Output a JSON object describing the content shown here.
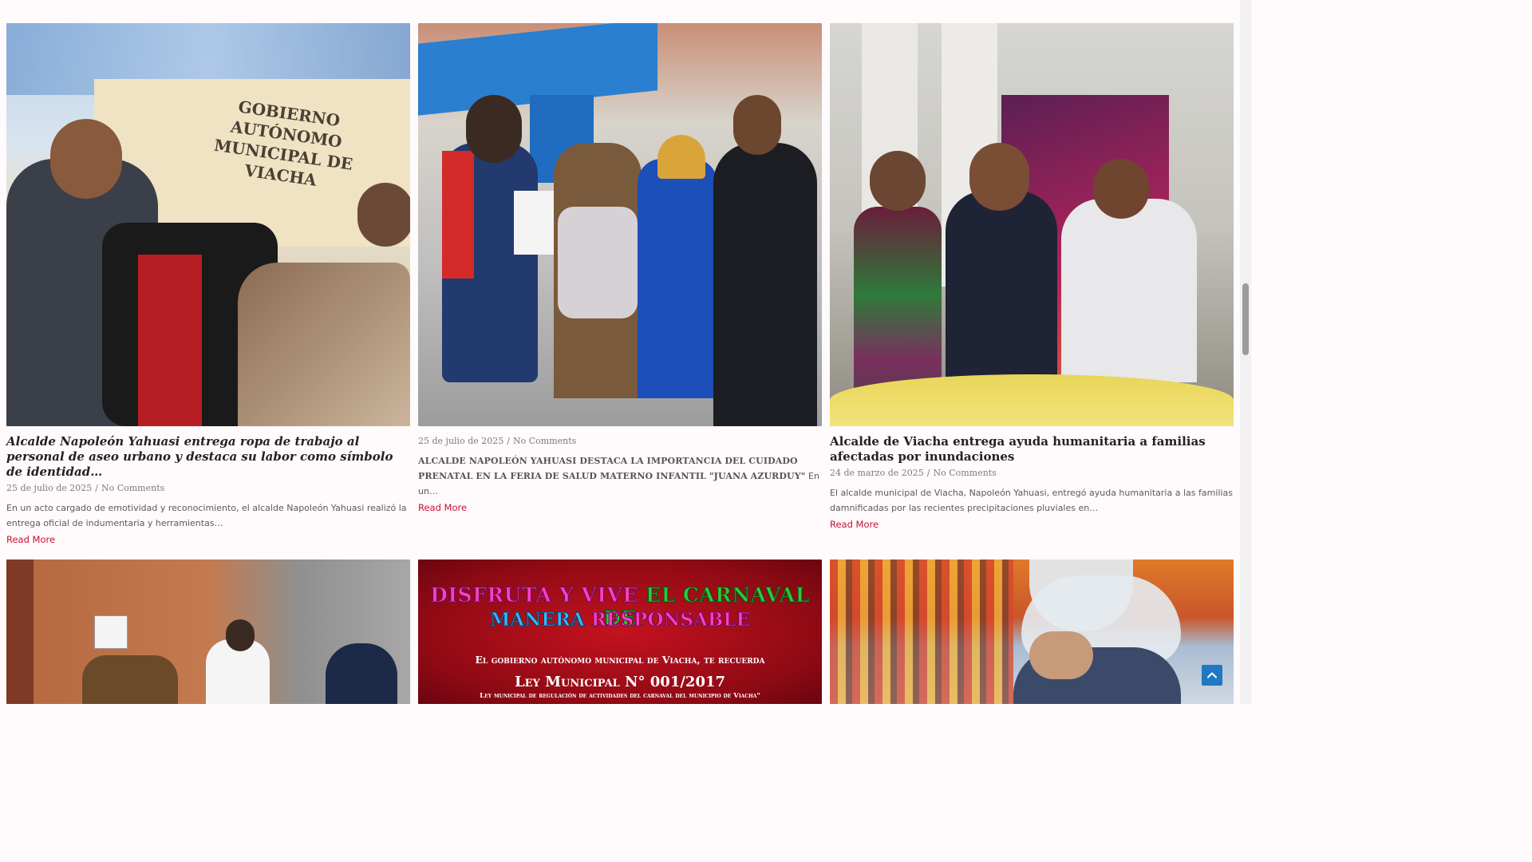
{
  "posts": [
    {
      "title": "Alcalde Napoleón Yahuasi entrega ropa de trabajo al personal de aseo urbano y destaca su labor como símbolo de identidad…",
      "date": "25 de julio de 2025",
      "comments": "No Comments",
      "excerpt": "En un acto cargado de emotividad y reconocimiento, el alcalde Napoleón Yahuasi realizó la entrega oficial de indumentaria y herramientas…",
      "read_more": "Read More",
      "photo_sign_line1": "GOBIERNO AUTÓNOMO",
      "photo_sign_line2": "MUNICIPAL DE VIACHA"
    },
    {
      "title": "",
      "date": "25 de julio de 2025",
      "comments": "No Comments",
      "excerpt_caps": "ALCALDE NAPOLEÓN YAHUASI DESTACA LA IMPORTANCIA DEL CUIDADO PRENATAL EN LA FERIA DE SALUD MATERNO INFANTIL \"JUANA AZURDUY\"",
      "excerpt": "En un…",
      "read_more": "Read More"
    },
    {
      "title": "Alcalde de Viacha entrega ayuda humanitaria a familias afectadas por inundaciones",
      "date": "24 de marzo de 2025",
      "comments": "No Comments",
      "excerpt": "El alcalde municipal de Viacha, Napoleón Yahuasi, entregó ayuda humanitaria a las familias damnificadas por las recientes precipitaciones pluviales en…",
      "read_more": "Read More"
    }
  ],
  "banner": {
    "line1a": "Disfruta y vive ",
    "line1b": "el carnaval de",
    "line2a": "manera ",
    "line2b": "responsable",
    "line3": "El gobierno autónomo municipal de Viacha, te recuerda",
    "line4": "Ley Municipal N° 001/2017",
    "line5": "Ley municipal de regulación de actividades del carnaval del municipio de Viacha\""
  },
  "meta_separator": "/",
  "colors": {
    "accent": "#c8102e",
    "to_top": "#1f78c1"
  },
  "icons": {
    "to_top": "chevron-up-icon"
  }
}
